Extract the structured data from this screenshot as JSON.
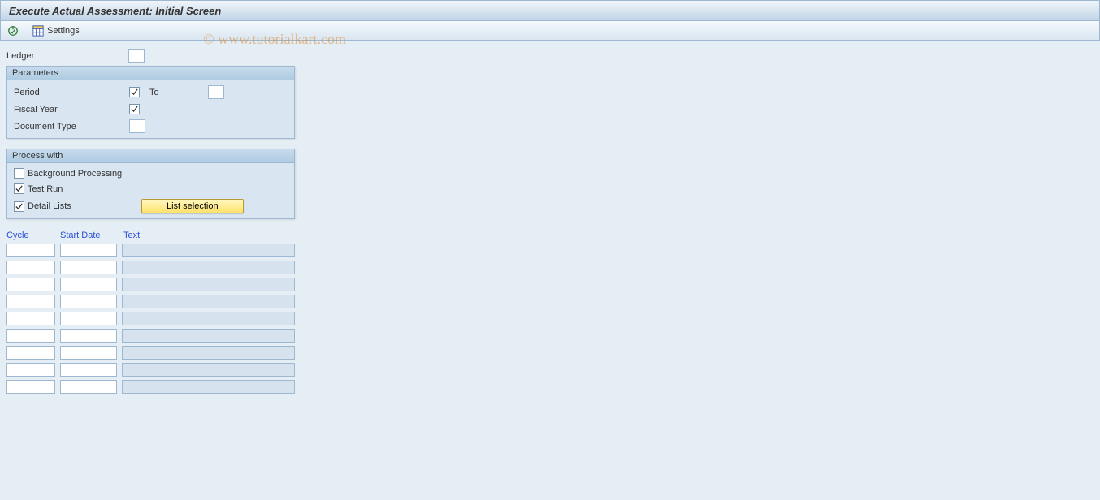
{
  "title": "Execute Actual Assessment: Initial Screen",
  "toolbar": {
    "settings_label": "Settings"
  },
  "watermark": "© www.tutorialkart.com",
  "fields": {
    "ledger_label": "Ledger"
  },
  "parameters": {
    "title": "Parameters",
    "period_label": "Period",
    "to_label": "To",
    "fiscal_year_label": "Fiscal Year",
    "doc_type_label": "Document Type"
  },
  "process": {
    "title": "Process with",
    "background_label": "Background Processing",
    "testrun_label": "Test Run",
    "detail_label": "Detail Lists",
    "list_selection_label": "List selection",
    "background_checked": false,
    "testrun_checked": true,
    "detail_checked": true
  },
  "table": {
    "headers": {
      "cycle": "Cycle",
      "start": "Start Date",
      "text": "Text"
    },
    "rows": [
      {
        "cycle": "",
        "start": "",
        "text": ""
      },
      {
        "cycle": "",
        "start": "",
        "text": ""
      },
      {
        "cycle": "",
        "start": "",
        "text": ""
      },
      {
        "cycle": "",
        "start": "",
        "text": ""
      },
      {
        "cycle": "",
        "start": "",
        "text": ""
      },
      {
        "cycle": "",
        "start": "",
        "text": ""
      },
      {
        "cycle": "",
        "start": "",
        "text": ""
      },
      {
        "cycle": "",
        "start": "",
        "text": ""
      },
      {
        "cycle": "",
        "start": "",
        "text": ""
      }
    ]
  }
}
